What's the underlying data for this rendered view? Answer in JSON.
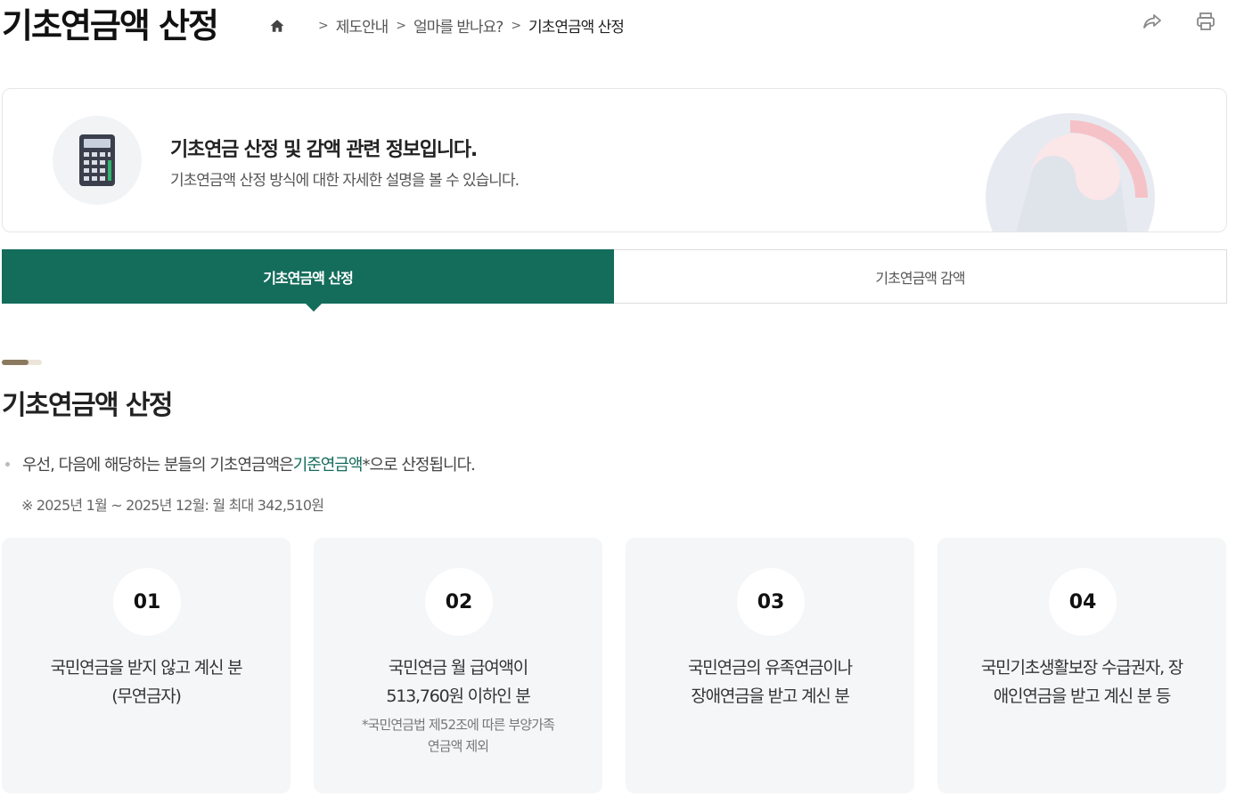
{
  "page": {
    "title": "기초연금액 산정"
  },
  "breadcrumb": {
    "home_icon": "home-icon",
    "items": [
      "제도안내",
      "얼마를 받나요?",
      "기초연금액 산정"
    ]
  },
  "actions": {
    "share_icon": "share-icon",
    "print_icon": "print-icon"
  },
  "info_box": {
    "icon": "calculator-icon",
    "title": "기초연금 산정 및 감액 관련 정보입니다.",
    "description": "기초연금액 산정 방식에 대한 자세한 설명을 볼 수 있습니다."
  },
  "tabs": [
    {
      "label": "기초연금액 산정",
      "active": true
    },
    {
      "label": "기초연금액 감액",
      "active": false
    }
  ],
  "section": {
    "title": "기초연금액 산정",
    "intro_before": "우선, 다음에 해당하는 분들의 기초연금액은 ",
    "intro_highlight": "기준연금액",
    "intro_after": "*으로 산정됩니다.",
    "note": "※ 2025년 1월 ~ 2025년 12월: 월 최대 342,510원"
  },
  "cards": [
    {
      "number": "01",
      "line1": "국민연금을 받지 않고 계신 분",
      "line2": "(무연금자)",
      "sub1": "",
      "sub2": ""
    },
    {
      "number": "02",
      "line1": "국민연금 월 급여액이",
      "line2": "513,760원 이하인 분",
      "sub1": "*국민연금법 제52조에 따른 부양가족",
      "sub2": "연금액 제외"
    },
    {
      "number": "03",
      "line1": "국민연금의 유족연금이나",
      "line2": "장애연금을 받고 계신 분",
      "sub1": "",
      "sub2": ""
    },
    {
      "number": "04",
      "line1": "국민기초생활보장 수급권자, 장",
      "line2": "애인연금을 받고 계신 분 등",
      "sub1": "",
      "sub2": ""
    }
  ],
  "colors": {
    "accent": "#146c5b",
    "card_bg": "#f5f6f8"
  }
}
